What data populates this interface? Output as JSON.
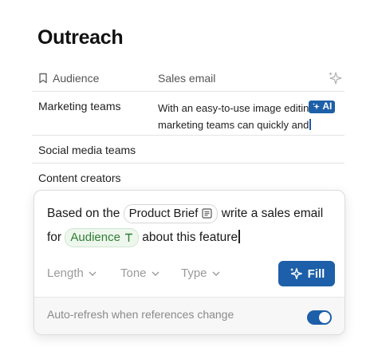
{
  "page": {
    "title": "Outreach"
  },
  "table": {
    "columns": [
      "Audience",
      "Sales email"
    ],
    "rows": [
      {
        "audience": "Marketing teams",
        "email_line1": "With an easy-to-use image editin",
        "email_line2": "marketing teams can quickly and"
      },
      {
        "audience": "Social media teams",
        "email_line1": "",
        "email_line2": ""
      },
      {
        "audience": "Content creators",
        "email_line1": "",
        "email_line2": ""
      }
    ],
    "ai_badge_label": "AI"
  },
  "prompt": {
    "part1": "Based on the",
    "chip_brief": "Product Brief",
    "part2": "write a sales email",
    "part3": "for",
    "chip_audience": "Audience",
    "part4": "about this feature"
  },
  "options": {
    "length": "Length",
    "tone": "Tone",
    "type": "Type"
  },
  "fill_button": "Fill",
  "footer": {
    "label": "Auto-refresh when references change",
    "toggle_on": true
  },
  "colors": {
    "accent": "#1d5fa8",
    "chip_green": "#2e7d32",
    "chip_green_bg": "#eef7ee"
  },
  "icons": [
    "bookmark-icon",
    "sparkle-icon",
    "text-icon",
    "chevron-down-icon"
  ]
}
